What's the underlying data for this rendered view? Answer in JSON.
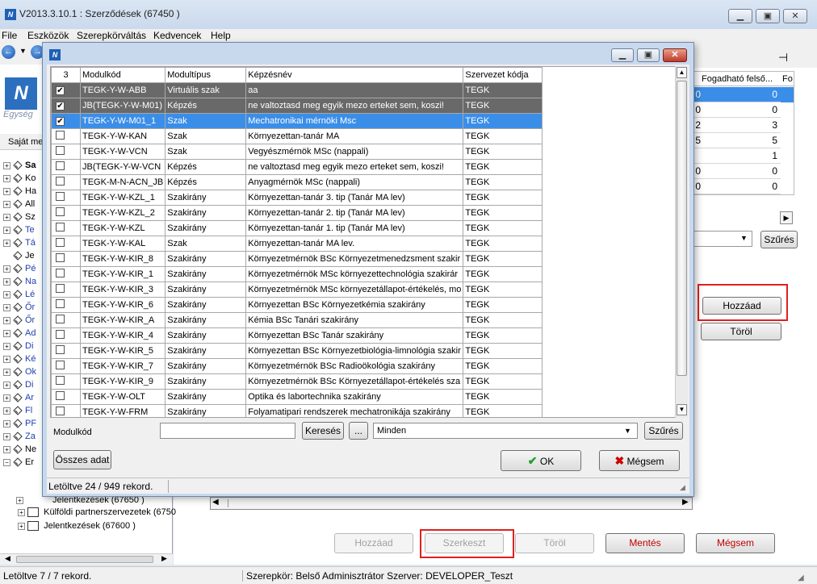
{
  "main_window": {
    "title": "V2013.3.10.1 : Szerződések (67450  )",
    "app_icon_text": "N",
    "menu": [
      "File",
      "Eszközök",
      "Szerepkörváltás",
      "Kedvencek",
      "Help"
    ],
    "left_pane": {
      "logo_subtitle": "Egység",
      "tab_label": "Saját me",
      "tree_items": [
        "Sa",
        "Ko",
        "Ha",
        "All",
        "Sz",
        "Te",
        "Tá",
        "Je",
        "Pé",
        "Na",
        "Lé",
        "Őr",
        "Őr",
        "Ad",
        "Di",
        "Ké",
        "Ok",
        "Di",
        "Ar",
        "Fl",
        "PF",
        "Za",
        "Ne",
        "Er"
      ],
      "subtree": [
        {
          "label": "Jelentkezések (67650  )"
        },
        {
          "label": "Külföldi partnerszervezetek (6750"
        },
        {
          "label": "Jelentkezések (67600  )"
        }
      ]
    },
    "bg_table": {
      "headers": [
        "Fogadható felső...",
        "Fo"
      ],
      "values": [
        "0",
        "0",
        "3",
        "5",
        "1",
        "0",
        "0"
      ],
      "left_digits": [
        "0",
        "0",
        "2",
        "5",
        "",
        "0",
        "0"
      ]
    },
    "szures_label": "Szűrés",
    "hozzaad_label": "Hozzáad",
    "torol_label": "Töröl",
    "bottom_buttons": {
      "add": "Hozzáad",
      "edit": "Szerkeszt",
      "delete": "Töröl",
      "save": "Mentés",
      "cancel": "Mégsem"
    },
    "status": {
      "left": "Letöltve 7 / 7 rekord.",
      "role": "Szerepkör: Belső Adminisztrátor   Szerver: DEVELOPER_Teszt"
    }
  },
  "dialog": {
    "icon_text": "N",
    "grid": {
      "headers": [
        "3",
        "Modulkód",
        "Modultípus",
        "Képzésnév",
        "Szervezet kódja"
      ],
      "rows": [
        {
          "checked": true,
          "code": "TEGK-Y-W-ABB",
          "type": "Virtuális szak",
          "name": "aa",
          "org": "TEGK",
          "style": "dark"
        },
        {
          "checked": true,
          "code": "JB(TEGK-Y-W-M01)",
          "type": "Képzés",
          "name": "ne valtoztasd meg egyik mezo erteket sem, koszi!",
          "org": "TEGK",
          "style": "dark"
        },
        {
          "checked": true,
          "code": "TEGK-Y-W-M01_1",
          "type": "Szak",
          "name": "Mechatronikai mérnöki Msc",
          "org": "TEGK",
          "style": "sel"
        },
        {
          "checked": false,
          "code": "TEGK-Y-W-KAN",
          "type": "Szak",
          "name": "Környezettan-tanár MA",
          "org": "TEGK",
          "style": ""
        },
        {
          "checked": false,
          "code": "TEGK-Y-W-VCN",
          "type": "Szak",
          "name": "Vegyészmérnök MSc (nappali)",
          "org": "TEGK",
          "style": ""
        },
        {
          "checked": false,
          "code": "JB(TEGK-Y-W-VCN",
          "type": "Képzés",
          "name": "ne valtoztasd meg egyik mezo erteket sem, koszi!",
          "org": "TEGK",
          "style": ""
        },
        {
          "checked": false,
          "code": "TEGK-M-N-ACN_JB",
          "type": "Képzés",
          "name": "Anyagmérnök MSc  (nappali)",
          "org": "TEGK",
          "style": ""
        },
        {
          "checked": false,
          "code": "TEGK-Y-W-KZL_1",
          "type": "Szakirány",
          "name": "Környezettan-tanár 3. tip (Tanár MA lev)",
          "org": "TEGK",
          "style": ""
        },
        {
          "checked": false,
          "code": "TEGK-Y-W-KZL_2",
          "type": "Szakirány",
          "name": "Környezettan-tanár 2. tip (Tanár MA lev)",
          "org": "TEGK",
          "style": ""
        },
        {
          "checked": false,
          "code": "TEGK-Y-W-KZL",
          "type": "Szakirány",
          "name": "Környezettan-tanár 1. tip (Tanár MA lev)",
          "org": "TEGK",
          "style": ""
        },
        {
          "checked": false,
          "code": "TEGK-Y-W-KAL",
          "type": "Szak",
          "name": "Környezettan-tanár MA lev.",
          "org": "TEGK",
          "style": ""
        },
        {
          "checked": false,
          "code": "TEGK-Y-W-KIR_8",
          "type": "Szakirány",
          "name": "Környezetmérnök BSc Környezetmenedzsment szakir",
          "org": "TEGK",
          "style": ""
        },
        {
          "checked": false,
          "code": "TEGK-Y-W-KIR_1",
          "type": "Szakirány",
          "name": "Környezetmérnök MSc környezettechnológia szakirár",
          "org": "TEGK",
          "style": ""
        },
        {
          "checked": false,
          "code": "TEGK-Y-W-KIR_3",
          "type": "Szakirány",
          "name": "Környezetmérnök MSc környezetállapot-értékelés, mo",
          "org": "TEGK",
          "style": ""
        },
        {
          "checked": false,
          "code": "TEGK-Y-W-KIR_6",
          "type": "Szakirány",
          "name": "Környezettan BSc Környezetkémia szakirány",
          "org": "TEGK",
          "style": ""
        },
        {
          "checked": false,
          "code": "TEGK-Y-W-KIR_A",
          "type": "Szakirány",
          "name": "Kémia BSc Tanári szakirány",
          "org": "TEGK",
          "style": ""
        },
        {
          "checked": false,
          "code": "TEGK-Y-W-KIR_4",
          "type": "Szakirány",
          "name": "Környezettan BSc Tanár szakirány",
          "org": "TEGK",
          "style": ""
        },
        {
          "checked": false,
          "code": "TEGK-Y-W-KIR_5",
          "type": "Szakirány",
          "name": "Környezettan BSc Környezetbiológia-limnológia szakir",
          "org": "TEGK",
          "style": ""
        },
        {
          "checked": false,
          "code": "TEGK-Y-W-KIR_7",
          "type": "Szakirány",
          "name": "Környezetmérnök BSc Radioökológia szakirány",
          "org": "TEGK",
          "style": ""
        },
        {
          "checked": false,
          "code": "TEGK-Y-W-KIR_9",
          "type": "Szakirány",
          "name": "Környezetmérnök BSc Környezetállapot-értékelés sza",
          "org": "TEGK",
          "style": ""
        },
        {
          "checked": false,
          "code": "TEGK-Y-W-OLT",
          "type": "Szakirány",
          "name": "Optika és labortechnika szakirány",
          "org": "TEGK",
          "style": ""
        },
        {
          "checked": false,
          "code": "TEGK-Y-W-FRM",
          "type": "Szakirány",
          "name": "Folyamatipari rendszerek mechatronikája szakirány",
          "org": "TEGK",
          "style": ""
        }
      ]
    },
    "filter": {
      "label": "Modulkód",
      "input_value": "",
      "search_button": "Keresés",
      "ellipsis_button": "...",
      "dropdown_value": "Minden",
      "filter_button": "Szűrés"
    },
    "all_data_button": "Összes adat",
    "ok_button": "OK",
    "cancel_button": "Mégsem",
    "status": "Letöltve 24 / 949 rekord."
  }
}
